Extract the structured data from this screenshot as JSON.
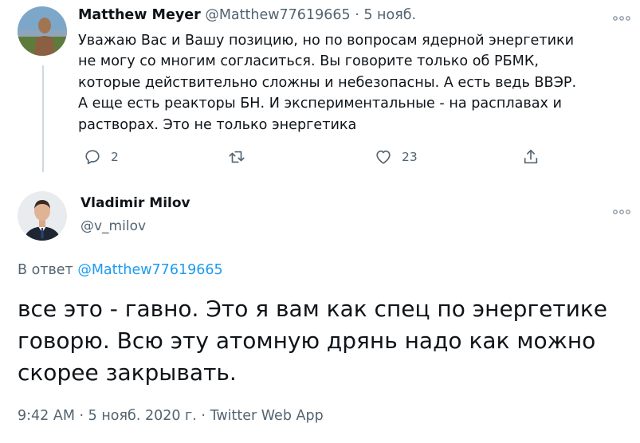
{
  "reply_tweet": {
    "author_name": "Matthew Meyer",
    "author_handle": "@Matthew77619665",
    "separator": "·",
    "date": "5 нояб.",
    "text": "Уважаю Вас и Вашу позицию, но по вопросам ядерной энергетики не могу со многим согласиться. Вы говорите только об РБМК, которые действительно сложны и небезопасны. А есть ведь ВВЭР. А еще есть реакторы БН. И экспериментальные - на расплавах и растворах. Это не только энергетика",
    "actions": {
      "reply_count": "2",
      "retweet_count": "",
      "like_count": "23"
    }
  },
  "main_tweet": {
    "author_name": "Vladimir Milov",
    "author_handle": "@v_milov",
    "reply_prefix": "В ответ",
    "reply_mention": "@Matthew77619665",
    "text": "все это - гавно. Это я вам как спец по энергетике говорю. Всю эту атомную дрянь надо как можно скорее закрывать.",
    "footer_time": "9:42 AM",
    "footer_sep": "·",
    "footer_date": "5 нояб. 2020 г.",
    "footer_source": "Twitter Web App"
  },
  "icons": {
    "more": "more-dots-icon",
    "reply": "reply-bubble-icon",
    "retweet": "retweet-icon",
    "like": "heart-icon",
    "share": "share-icon"
  },
  "colors": {
    "text": "#0f1419",
    "secondary": "#536471",
    "link": "#1d9bf0",
    "thread_line": "#cfd9de"
  }
}
